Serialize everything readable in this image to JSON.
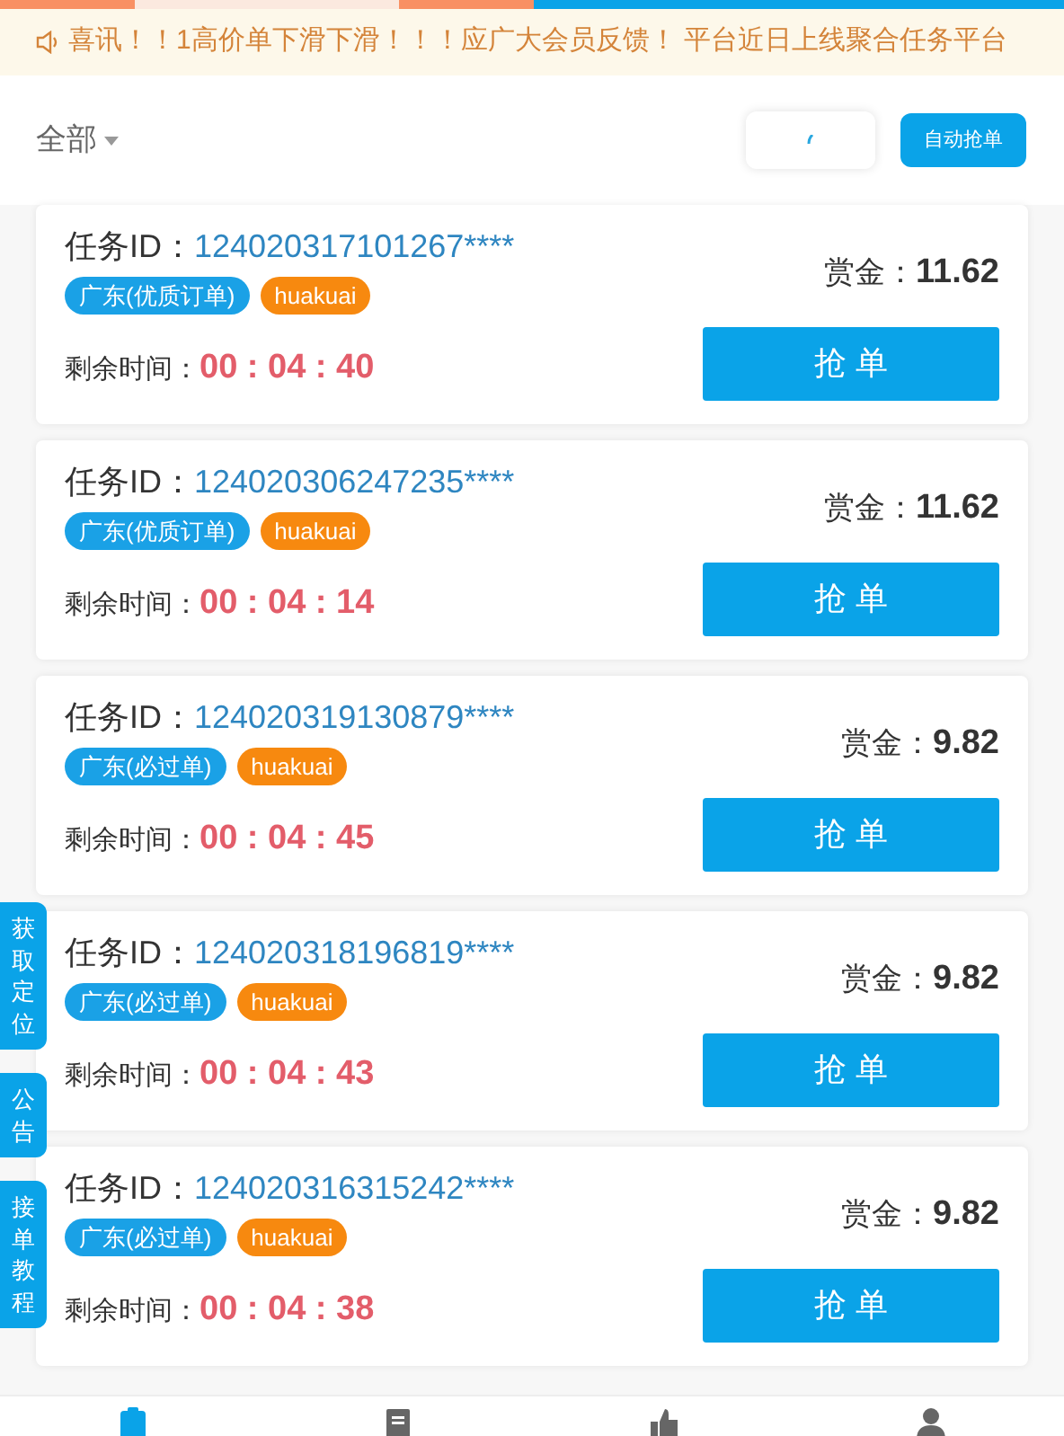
{
  "notice": "喜讯！！1高价单下滑下滑！！！应广大会员反馈！ 平台近日上线聚合任务平台",
  "filter": {
    "label": "全部"
  },
  "auto_button": "自动抢单",
  "tasks": [
    {
      "id_label": "任务ID：",
      "id": "124020317101267****",
      "tags": [
        {
          "text": "广东(优质订单)",
          "color": "#1aa1e6"
        },
        {
          "text": "huakuai",
          "color": "#f7890f"
        }
      ],
      "reward_label": "赏金：",
      "reward": "11.62",
      "time_label": "剩余时间：",
      "time": "00 : 04 : 40",
      "button": "抢 单"
    },
    {
      "id_label": "任务ID：",
      "id": "124020306247235****",
      "tags": [
        {
          "text": "广东(优质订单)",
          "color": "#1aa1e6"
        },
        {
          "text": "huakuai",
          "color": "#f7890f"
        }
      ],
      "reward_label": "赏金：",
      "reward": "11.62",
      "time_label": "剩余时间：",
      "time": "00 : 04 : 14",
      "button": "抢 单"
    },
    {
      "id_label": "任务ID：",
      "id": "124020319130879****",
      "tags": [
        {
          "text": "广东(必过单)",
          "color": "#1aa1e6"
        },
        {
          "text": "huakuai",
          "color": "#f7890f"
        }
      ],
      "reward_label": "赏金：",
      "reward": "9.82",
      "time_label": "剩余时间：",
      "time": "00 : 04 : 45",
      "button": "抢 单"
    },
    {
      "id_label": "任务ID：",
      "id": "124020318196819****",
      "tags": [
        {
          "text": "广东(必过单)",
          "color": "#1aa1e6"
        },
        {
          "text": "huakuai",
          "color": "#f7890f"
        }
      ],
      "reward_label": "赏金：",
      "reward": "9.82",
      "time_label": "剩余时间：",
      "time": "00 : 04 : 43",
      "button": "抢 单"
    },
    {
      "id_label": "任务ID：",
      "id": "124020316315242****",
      "tags": [
        {
          "text": "广东(必过单)",
          "color": "#1aa1e6"
        },
        {
          "text": "huakuai",
          "color": "#f7890f"
        }
      ],
      "reward_label": "赏金：",
      "reward": "9.82",
      "time_label": "剩余时间：",
      "time": "00 : 04 : 38",
      "button": "抢 单"
    }
  ],
  "side_tabs": [
    "获取定位",
    "公告",
    "接单教程"
  ],
  "bottom_nav": [
    {
      "kind": "order",
      "selected": true
    },
    {
      "kind": "document",
      "selected": false
    },
    {
      "kind": "like",
      "selected": false
    },
    {
      "kind": "user",
      "selected": false
    }
  ]
}
